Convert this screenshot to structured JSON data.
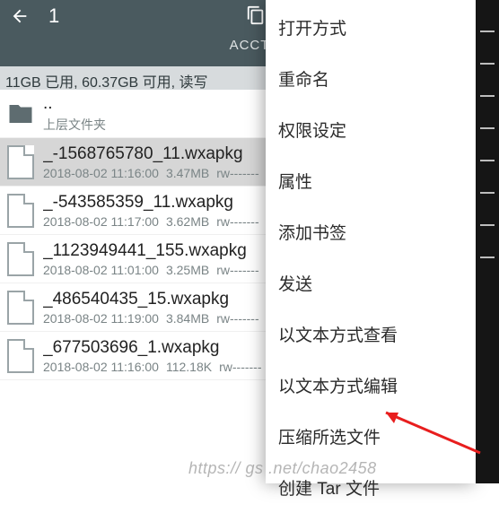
{
  "header": {
    "selected_count": "1",
    "tab_label": "ACCT"
  },
  "storage": {
    "text": "11GB 已用, 60.37GB 可用, 读写"
  },
  "parent": {
    "name": "..",
    "sub": "上层文件夹"
  },
  "files": [
    {
      "name": "_-1568765780_11.wxapkg",
      "date": "2018-08-02 11:16:00",
      "size": "3.47MB",
      "perm": "rw-------",
      "selected": true
    },
    {
      "name": "_-543585359_11.wxapkg",
      "date": "2018-08-02 11:17:00",
      "size": "3.62MB",
      "perm": "rw-------",
      "selected": false
    },
    {
      "name": "_1123949441_155.wxapkg",
      "date": "2018-08-02 11:01:00",
      "size": "3.25MB",
      "perm": "rw-------",
      "selected": false
    },
    {
      "name": "_486540435_15.wxapkg",
      "date": "2018-08-02 11:19:00",
      "size": "3.84MB",
      "perm": "rw-------",
      "selected": false
    },
    {
      "name": "_677503696_1.wxapkg",
      "date": "2018-08-02 11:16:00",
      "size": "112.18K",
      "perm": "rw-------",
      "selected": false
    }
  ],
  "menu": {
    "items": [
      "打开方式",
      "重命名",
      "权限设定",
      "属性",
      "添加书签",
      "发送",
      "以文本方式查看",
      "以文本方式编辑",
      "压缩所选文件",
      "创建 Tar 文件"
    ]
  },
  "watermark": "https://    gs    .net/chao2458"
}
